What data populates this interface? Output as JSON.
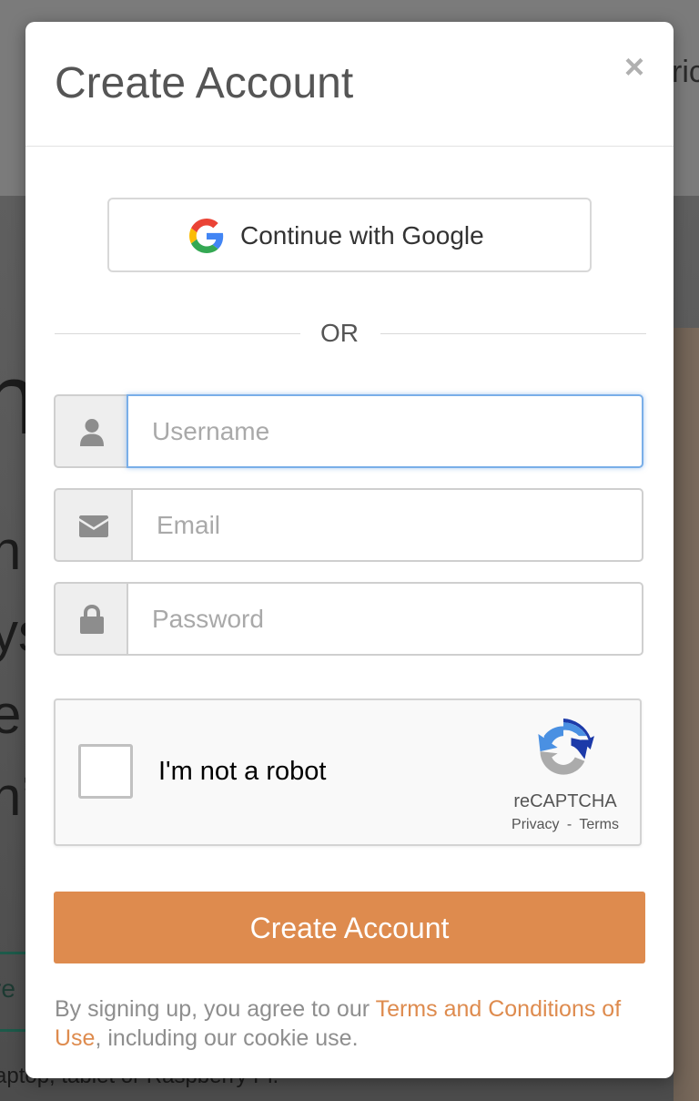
{
  "background": {
    "nav_fragment": "ric",
    "hero_line_1": "nþ",
    "hero_line_2": "n",
    "hero_line_3": "ys",
    "hero_line_4": "e",
    "hero_line_5": "n’",
    "button_fragment": "re",
    "footer_fragment": "aptop, tablet or Raspberry Pi."
  },
  "modal": {
    "title": "Create Account",
    "close_glyph": "×",
    "google_label": "Continue with Google",
    "divider_text": "OR",
    "fields": {
      "username": {
        "placeholder": "Username",
        "value": ""
      },
      "email": {
        "placeholder": "Email",
        "value": ""
      },
      "password": {
        "placeholder": "Password",
        "value": ""
      }
    },
    "recaptcha": {
      "label": "I'm not a robot",
      "brand": "reCAPTCHA",
      "privacy": "Privacy",
      "separator": "-",
      "terms": "Terms"
    },
    "submit_label": "Create Account",
    "legal": {
      "prefix": "By signing up, you agree to our ",
      "link_text": "Terms and Conditions of Use",
      "suffix": ", including our cookie use."
    }
  },
  "colors": {
    "accent": "#de8b4e",
    "focus_ring": "#79aee8"
  },
  "icons": [
    "close-icon",
    "google-icon",
    "user-icon",
    "envelope-icon",
    "lock-icon",
    "recaptcha-icon"
  ]
}
